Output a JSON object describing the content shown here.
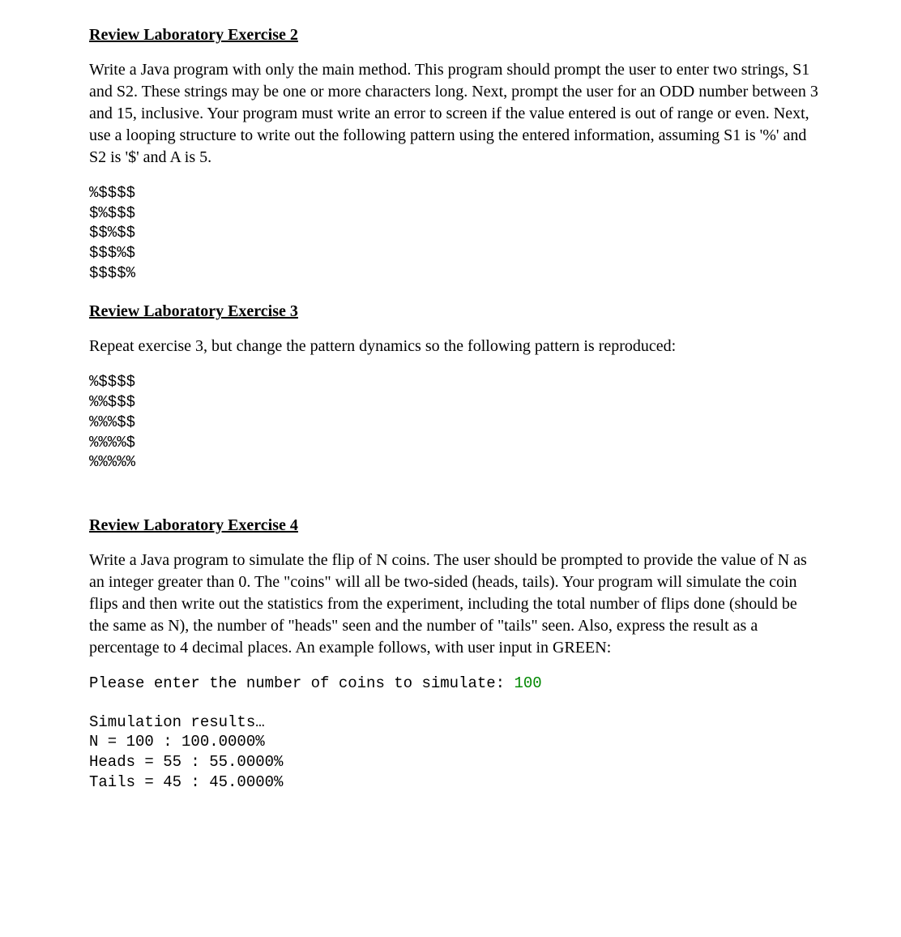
{
  "exercise2": {
    "heading": "Review Laboratory Exercise 2",
    "paragraph": "Write a Java program with only the main method. This program should prompt the user to enter two strings, S1 and S2. These strings may be one or more characters long. Next, prompt the user for an ODD number between 3 and 15, inclusive. Your program must write an error to screen if the value entered is out of range or even. Next, use a looping structure to write out the following pattern using the entered information, assuming S1 is '%' and S2 is '$' and A is 5.",
    "pattern": "%$$$$\n$%$$$\n$$%$$\n$$$%$\n$$$$%"
  },
  "exercise3": {
    "heading": "Review Laboratory Exercise 3",
    "paragraph": "Repeat exercise 3, but change the pattern dynamics so the following pattern is reproduced:",
    "pattern": "%$$$$\n%%$$$\n%%%$$\n%%%%$\n%%%%%"
  },
  "exercise4": {
    "heading": "Review Laboratory Exercise 4",
    "paragraph": "Write a Java program to simulate the flip of N coins. The user should be prompted to provide the value of N as an integer greater than 0. The \"coins\" will all be two-sided (heads, tails). Your program will simulate the coin flips and then write out the statistics from the experiment, including the total number of flips done (should be the same as N), the number of \"heads\" seen and the number of \"tails\" seen. Also, express the result as a percentage to 4 decimal places. An example follows, with user input in GREEN:",
    "prompt_text": "Please enter the number of coins to simulate: ",
    "user_input": "100",
    "results_heading": "Simulation results…",
    "result_n": "N = 100 : 100.0000%",
    "result_heads": "Heads = 55 : 55.0000%",
    "result_tails": "Tails = 45 : 45.0000%"
  }
}
